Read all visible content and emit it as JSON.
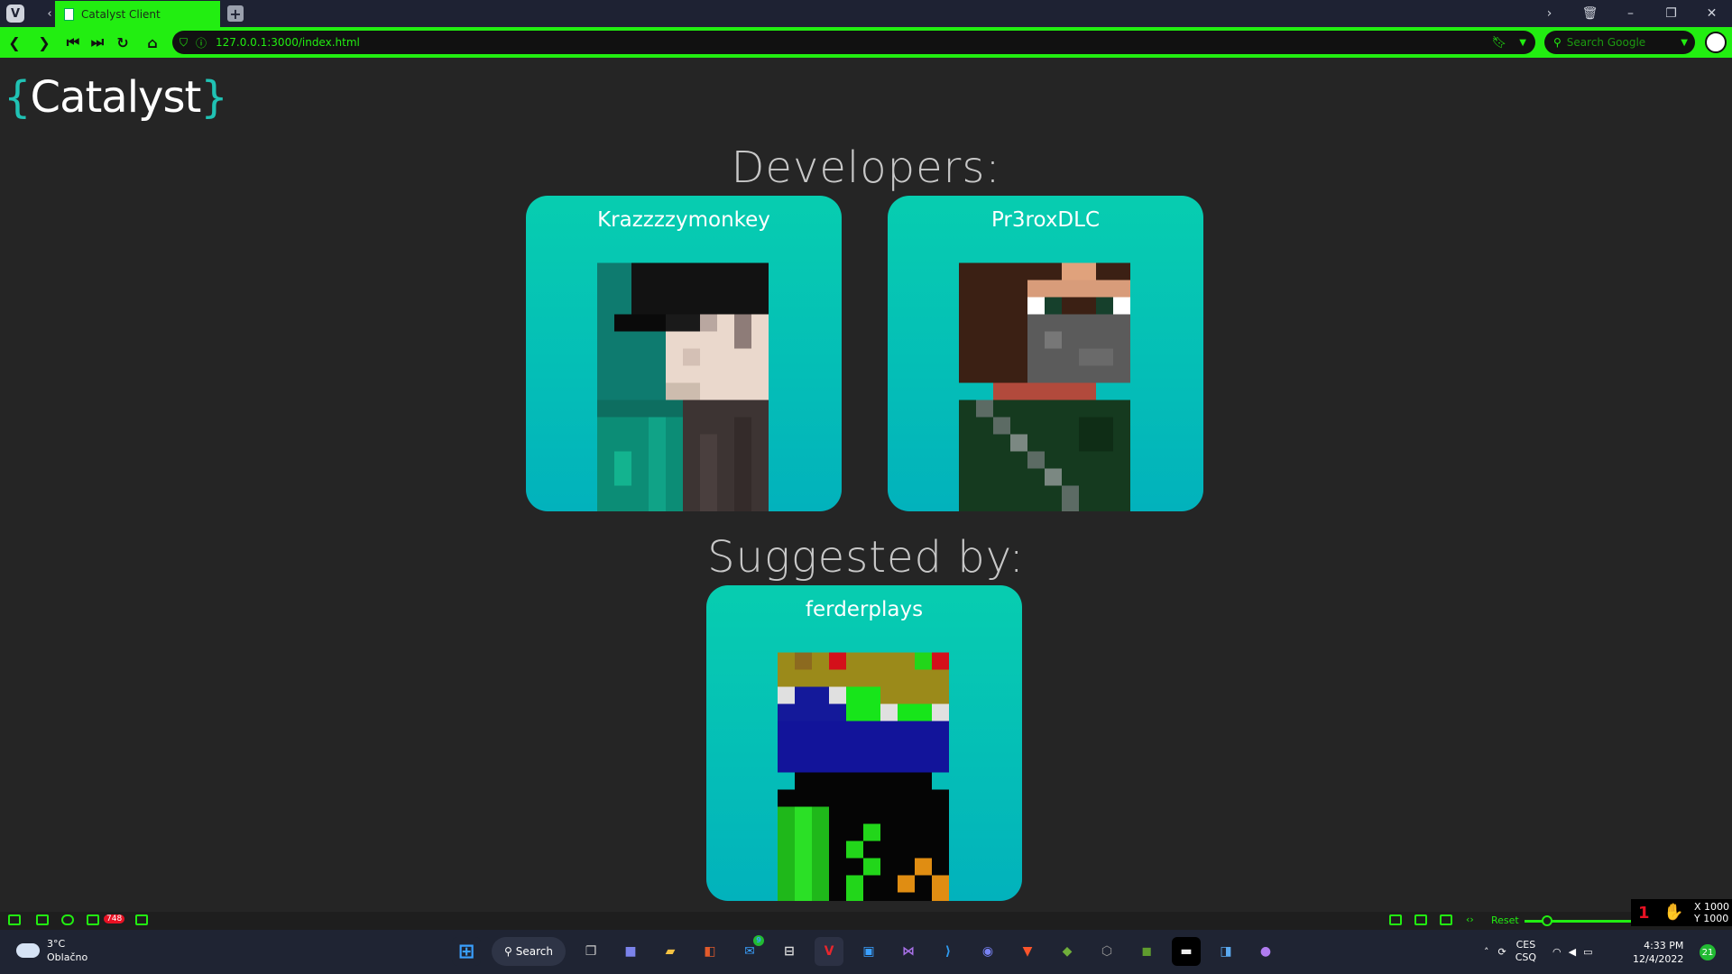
{
  "browser": {
    "tab_title": "Catalyst Client",
    "url": "127.0.0.1:3000/index.html",
    "search_placeholder": "Search Google"
  },
  "page": {
    "logo_open": "{",
    "logo_text": "Catalyst",
    "logo_close": "}",
    "developers_heading": "Developers:",
    "suggested_heading": "Suggested by:",
    "developers": [
      {
        "name": "Krazzzzymonkey"
      },
      {
        "name": "Pr3roxDLC"
      }
    ],
    "suggested": [
      {
        "name": "ferderplays"
      }
    ]
  },
  "statusbar": {
    "mail_count": "748",
    "reset_label": "Reset",
    "x_readout": "X 1000",
    "y_readout": "Y 1000"
  },
  "taskbar": {
    "weather_temp": "3°C",
    "weather_desc": "Oblačno",
    "search_label": "Search",
    "lang_top": "CES",
    "lang_bottom": "CSQ",
    "time": "4:33 PM",
    "date": "12/4/2022",
    "notification_count": "21",
    "mail_badge": "9"
  },
  "colors": {
    "accent": "#22ee11",
    "card_top": "#07cdb0",
    "card_bottom": "#02b2bc",
    "logo_brace": "#20c2b4"
  }
}
